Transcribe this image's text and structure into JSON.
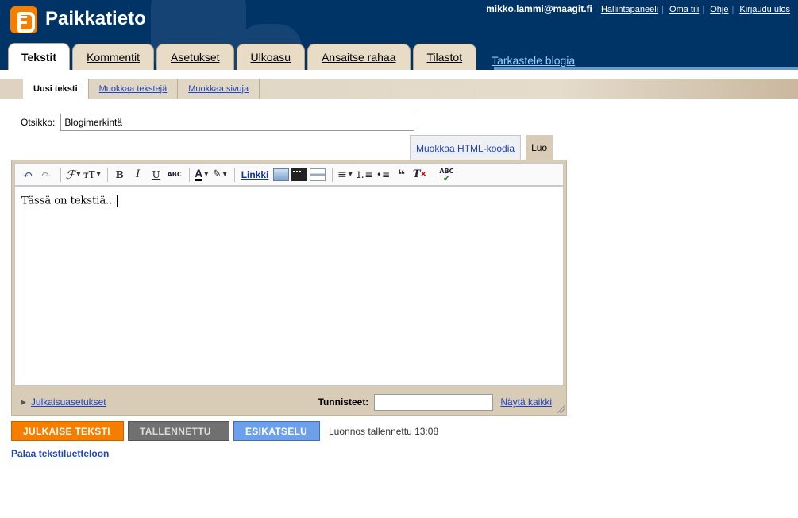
{
  "header": {
    "blog_title": "Paikkatieto",
    "user_email": "mikko.lammi@maagit.fi",
    "links": [
      "Hallintapaneeli",
      "Oma tili",
      "Ohje",
      "Kirjaudu ulos"
    ]
  },
  "tabs": [
    {
      "label": "Tekstit",
      "active": true
    },
    {
      "label": "Kommentit"
    },
    {
      "label": "Asetukset"
    },
    {
      "label": "Ulkoasu"
    },
    {
      "label": "Ansaitse rahaa"
    },
    {
      "label": "Tilastot"
    }
  ],
  "view_blog_link": "Tarkastele blogia",
  "subtabs": [
    "Uusi teksti",
    "Muokkaa tekstejä",
    "Muokkaa sivuja"
  ],
  "post": {
    "title_label": "Otsikko:",
    "title_value": "Blogimerkintä",
    "body_text": "Tässä on tekstiä..."
  },
  "mode_tabs": {
    "html": "Muokkaa HTML-koodia",
    "compose": "Luo"
  },
  "toolbar": {
    "link_label": "Linkki",
    "icons": [
      "undo-icon",
      "redo-icon",
      "font-icon",
      "font-size-icon",
      "bold-icon",
      "italic-icon",
      "underline-icon",
      "strikethrough-icon",
      "text-color-icon",
      "highlight-icon",
      "image-icon",
      "video-icon",
      "jump-break-icon",
      "align-icon",
      "numbered-list-icon",
      "bullet-list-icon",
      "blockquote-icon",
      "remove-format-icon",
      "spellcheck-icon"
    ],
    "strike_text": "ABC",
    "spell_text": "ABC"
  },
  "footer": {
    "publish_options": "Julkaisuasetukset",
    "tags_label": "Tunnisteet:",
    "tags_value": "",
    "show_all": "Näytä kaikki"
  },
  "buttons": {
    "publish": "JULKAISE TEKSTI",
    "saved": "TALLENNETTU",
    "preview": "ESIKATSELU"
  },
  "draft_status": "Luonnos tallennettu 13:08",
  "back_link": "Palaa tekstiluetteloon",
  "colors": {
    "header_bg": "#003366",
    "publish": "#f57d00",
    "preview": "#6d9fea",
    "saved": "#707070"
  }
}
